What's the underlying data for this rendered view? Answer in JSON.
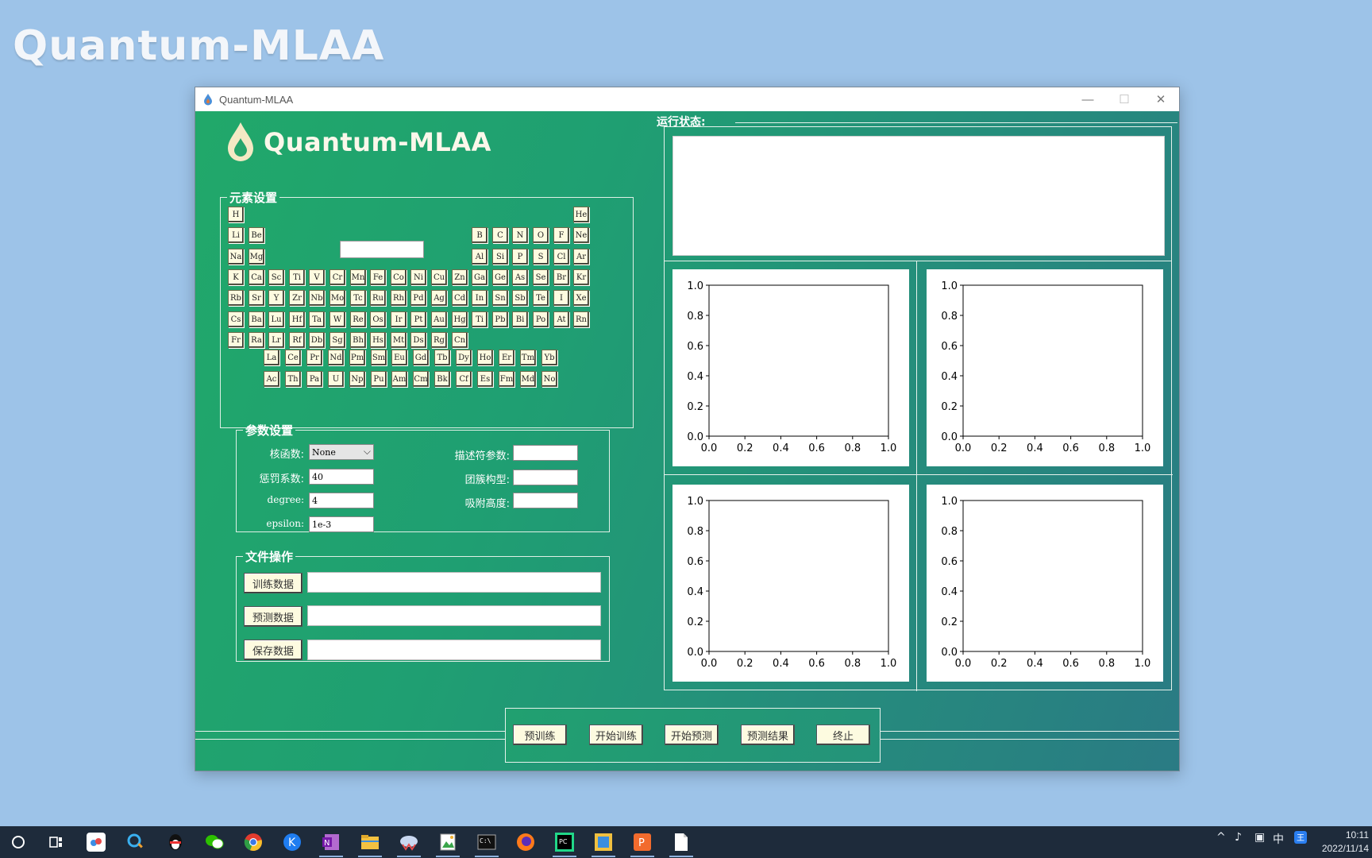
{
  "desktop": {
    "title": "Quantum-MLAA"
  },
  "window": {
    "title": "Quantum-MLAA",
    "minimize": "—",
    "maximize": "☐",
    "close": "✕"
  },
  "app": {
    "logo_text": "Quantum-MLAA"
  },
  "elements_section": {
    "legend": "元素设置",
    "elements": [
      {
        "s": "H",
        "r": 0,
        "c": 0
      },
      {
        "s": "He",
        "r": 0,
        "c": 17
      },
      {
        "s": "Li",
        "r": 1,
        "c": 0
      },
      {
        "s": "Be",
        "r": 1,
        "c": 1
      },
      {
        "s": "B",
        "r": 1,
        "c": 12
      },
      {
        "s": "C",
        "r": 1,
        "c": 13
      },
      {
        "s": "N",
        "r": 1,
        "c": 14
      },
      {
        "s": "O",
        "r": 1,
        "c": 15
      },
      {
        "s": "F",
        "r": 1,
        "c": 16
      },
      {
        "s": "Ne",
        "r": 1,
        "c": 17
      },
      {
        "s": "Na",
        "r": 2,
        "c": 0
      },
      {
        "s": "Mg",
        "r": 2,
        "c": 1
      },
      {
        "s": "Al",
        "r": 2,
        "c": 12
      },
      {
        "s": "Si",
        "r": 2,
        "c": 13
      },
      {
        "s": "P",
        "r": 2,
        "c": 14
      },
      {
        "s": "S",
        "r": 2,
        "c": 15
      },
      {
        "s": "Cl",
        "r": 2,
        "c": 16
      },
      {
        "s": "Ar",
        "r": 2,
        "c": 17
      },
      {
        "s": "K",
        "r": 3,
        "c": 0
      },
      {
        "s": "Ca",
        "r": 3,
        "c": 1
      },
      {
        "s": "Sc",
        "r": 3,
        "c": 2
      },
      {
        "s": "Ti",
        "r": 3,
        "c": 3
      },
      {
        "s": "V",
        "r": 3,
        "c": 4
      },
      {
        "s": "Cr",
        "r": 3,
        "c": 5
      },
      {
        "s": "Mn",
        "r": 3,
        "c": 6
      },
      {
        "s": "Fe",
        "r": 3,
        "c": 7
      },
      {
        "s": "Co",
        "r": 3,
        "c": 8
      },
      {
        "s": "Ni",
        "r": 3,
        "c": 9
      },
      {
        "s": "Cu",
        "r": 3,
        "c": 10
      },
      {
        "s": "Zn",
        "r": 3,
        "c": 11
      },
      {
        "s": "Ga",
        "r": 3,
        "c": 12
      },
      {
        "s": "Ge",
        "r": 3,
        "c": 13
      },
      {
        "s": "As",
        "r": 3,
        "c": 14
      },
      {
        "s": "Se",
        "r": 3,
        "c": 15
      },
      {
        "s": "Br",
        "r": 3,
        "c": 16
      },
      {
        "s": "Kr",
        "r": 3,
        "c": 17
      },
      {
        "s": "Rb",
        "r": 4,
        "c": 0
      },
      {
        "s": "Sr",
        "r": 4,
        "c": 1
      },
      {
        "s": "Y",
        "r": 4,
        "c": 2
      },
      {
        "s": "Zr",
        "r": 4,
        "c": 3
      },
      {
        "s": "Nb",
        "r": 4,
        "c": 4
      },
      {
        "s": "Mo",
        "r": 4,
        "c": 5
      },
      {
        "s": "Tc",
        "r": 4,
        "c": 6
      },
      {
        "s": "Ru",
        "r": 4,
        "c": 7
      },
      {
        "s": "Rh",
        "r": 4,
        "c": 8
      },
      {
        "s": "Pd",
        "r": 4,
        "c": 9
      },
      {
        "s": "Ag",
        "r": 4,
        "c": 10
      },
      {
        "s": "Cd",
        "r": 4,
        "c": 11
      },
      {
        "s": "In",
        "r": 4,
        "c": 12
      },
      {
        "s": "Sn",
        "r": 4,
        "c": 13
      },
      {
        "s": "Sb",
        "r": 4,
        "c": 14
      },
      {
        "s": "Te",
        "r": 4,
        "c": 15
      },
      {
        "s": "I",
        "r": 4,
        "c": 16
      },
      {
        "s": "Xe",
        "r": 4,
        "c": 17
      },
      {
        "s": "Cs",
        "r": 5,
        "c": 0
      },
      {
        "s": "Ba",
        "r": 5,
        "c": 1
      },
      {
        "s": "Lu",
        "r": 5,
        "c": 2
      },
      {
        "s": "Hf",
        "r": 5,
        "c": 3
      },
      {
        "s": "Ta",
        "r": 5,
        "c": 4
      },
      {
        "s": "W",
        "r": 5,
        "c": 5
      },
      {
        "s": "Re",
        "r": 5,
        "c": 6
      },
      {
        "s": "Os",
        "r": 5,
        "c": 7
      },
      {
        "s": "Ir",
        "r": 5,
        "c": 8
      },
      {
        "s": "Pt",
        "r": 5,
        "c": 9
      },
      {
        "s": "Au",
        "r": 5,
        "c": 10
      },
      {
        "s": "Hg",
        "r": 5,
        "c": 11
      },
      {
        "s": "Ti",
        "r": 5,
        "c": 12
      },
      {
        "s": "Pb",
        "r": 5,
        "c": 13
      },
      {
        "s": "Bi",
        "r": 5,
        "c": 14
      },
      {
        "s": "Po",
        "r": 5,
        "c": 15
      },
      {
        "s": "At",
        "r": 5,
        "c": 16
      },
      {
        "s": "Rn",
        "r": 5,
        "c": 17
      },
      {
        "s": "Fr",
        "r": 6,
        "c": 0
      },
      {
        "s": "Ra",
        "r": 6,
        "c": 1
      },
      {
        "s": "Lr",
        "r": 6,
        "c": 2
      },
      {
        "s": "Rf",
        "r": 6,
        "c": 3
      },
      {
        "s": "Db",
        "r": 6,
        "c": 4
      },
      {
        "s": "Sg",
        "r": 6,
        "c": 5
      },
      {
        "s": "Bh",
        "r": 6,
        "c": 6
      },
      {
        "s": "Hs",
        "r": 6,
        "c": 7
      },
      {
        "s": "Mt",
        "r": 6,
        "c": 8
      },
      {
        "s": "Ds",
        "r": 6,
        "c": 9
      },
      {
        "s": "Rg",
        "r": 6,
        "c": 10
      },
      {
        "s": "Cn",
        "r": 6,
        "c": 11
      },
      {
        "s": "La",
        "r": 7,
        "c": 0
      },
      {
        "s": "Ce",
        "r": 7,
        "c": 1
      },
      {
        "s": "Pr",
        "r": 7,
        "c": 2
      },
      {
        "s": "Nd",
        "r": 7,
        "c": 3
      },
      {
        "s": "Pm",
        "r": 7,
        "c": 4
      },
      {
        "s": "Sm",
        "r": 7,
        "c": 5
      },
      {
        "s": "Eu",
        "r": 7,
        "c": 6
      },
      {
        "s": "Gd",
        "r": 7,
        "c": 7
      },
      {
        "s": "Tb",
        "r": 7,
        "c": 8
      },
      {
        "s": "Dy",
        "r": 7,
        "c": 9
      },
      {
        "s": "Ho",
        "r": 7,
        "c": 10
      },
      {
        "s": "Er",
        "r": 7,
        "c": 11
      },
      {
        "s": "Tm",
        "r": 7,
        "c": 12
      },
      {
        "s": "Yb",
        "r": 7,
        "c": 13
      },
      {
        "s": "Ac",
        "r": 8,
        "c": 0
      },
      {
        "s": "Th",
        "r": 8,
        "c": 1
      },
      {
        "s": "Pa",
        "r": 8,
        "c": 2
      },
      {
        "s": "U",
        "r": 8,
        "c": 3
      },
      {
        "s": "Np",
        "r": 8,
        "c": 4
      },
      {
        "s": "Pu",
        "r": 8,
        "c": 5
      },
      {
        "s": "Am",
        "r": 8,
        "c": 6
      },
      {
        "s": "Cm",
        "r": 8,
        "c": 7
      },
      {
        "s": "Bk",
        "r": 8,
        "c": 8
      },
      {
        "s": "Cf",
        "r": 8,
        "c": 9
      },
      {
        "s": "Es",
        "r": 8,
        "c": 10
      },
      {
        "s": "Fm",
        "r": 8,
        "c": 11
      },
      {
        "s": "Md",
        "r": 8,
        "c": 12
      },
      {
        "s": "No",
        "r": 8,
        "c": 13
      }
    ]
  },
  "params": {
    "legend": "参数设置",
    "kernel_label": "核函数:",
    "kernel_value": "None",
    "penalty_label": "惩罚系数:",
    "penalty_value": "40",
    "degree_label": "degree:",
    "degree_value": "4",
    "epsilon_label": "epsilon:",
    "epsilon_value": "1e-3",
    "descriptor_label": "描述符参数:",
    "descriptor_value": "",
    "cluster_label": "团簇构型:",
    "cluster_value": "",
    "height_label": "吸附高度:",
    "height_value": ""
  },
  "files": {
    "legend": "文件操作",
    "train_button": "训练数据",
    "train_path": "",
    "predict_button": "预测数据",
    "predict_path": "",
    "save_button": "保存数据",
    "save_path": ""
  },
  "actions": {
    "pretrain": "预训练",
    "start_train": "开始训练",
    "start_predict": "开始预测",
    "predict_result": "预测结果",
    "stop": "终止"
  },
  "status": {
    "label": "运行状态:",
    "text": ""
  },
  "chart_data": [
    {
      "type": "line",
      "xlim": [
        0,
        1
      ],
      "ylim": [
        0,
        1
      ],
      "xticks": [
        "0.0",
        "0.2",
        "0.4",
        "0.6",
        "0.8",
        "1.0"
      ],
      "yticks": [
        "0.0",
        "0.2",
        "0.4",
        "0.6",
        "0.8",
        "1.0"
      ],
      "series": []
    },
    {
      "type": "line",
      "xlim": [
        0,
        1
      ],
      "ylim": [
        0,
        1
      ],
      "xticks": [
        "0.0",
        "0.2",
        "0.4",
        "0.6",
        "0.8",
        "1.0"
      ],
      "yticks": [
        "0.0",
        "0.2",
        "0.4",
        "0.6",
        "0.8",
        "1.0"
      ],
      "series": []
    },
    {
      "type": "line",
      "xlim": [
        0,
        1
      ],
      "ylim": [
        0,
        1
      ],
      "xticks": [
        "0.0",
        "0.2",
        "0.4",
        "0.6",
        "0.8",
        "1.0"
      ],
      "yticks": [
        "0.0",
        "0.2",
        "0.4",
        "0.6",
        "0.8",
        "1.0"
      ],
      "series": []
    },
    {
      "type": "line",
      "xlim": [
        0,
        1
      ],
      "ylim": [
        0,
        1
      ],
      "xticks": [
        "0.0",
        "0.2",
        "0.4",
        "0.6",
        "0.8",
        "1.0"
      ],
      "yticks": [
        "0.0",
        "0.2",
        "0.4",
        "0.6",
        "0.8",
        "1.0"
      ],
      "series": []
    }
  ],
  "taskbar": {
    "tray_ime": "中",
    "clock_time": "10:11",
    "clock_date": "2022/11/14"
  }
}
